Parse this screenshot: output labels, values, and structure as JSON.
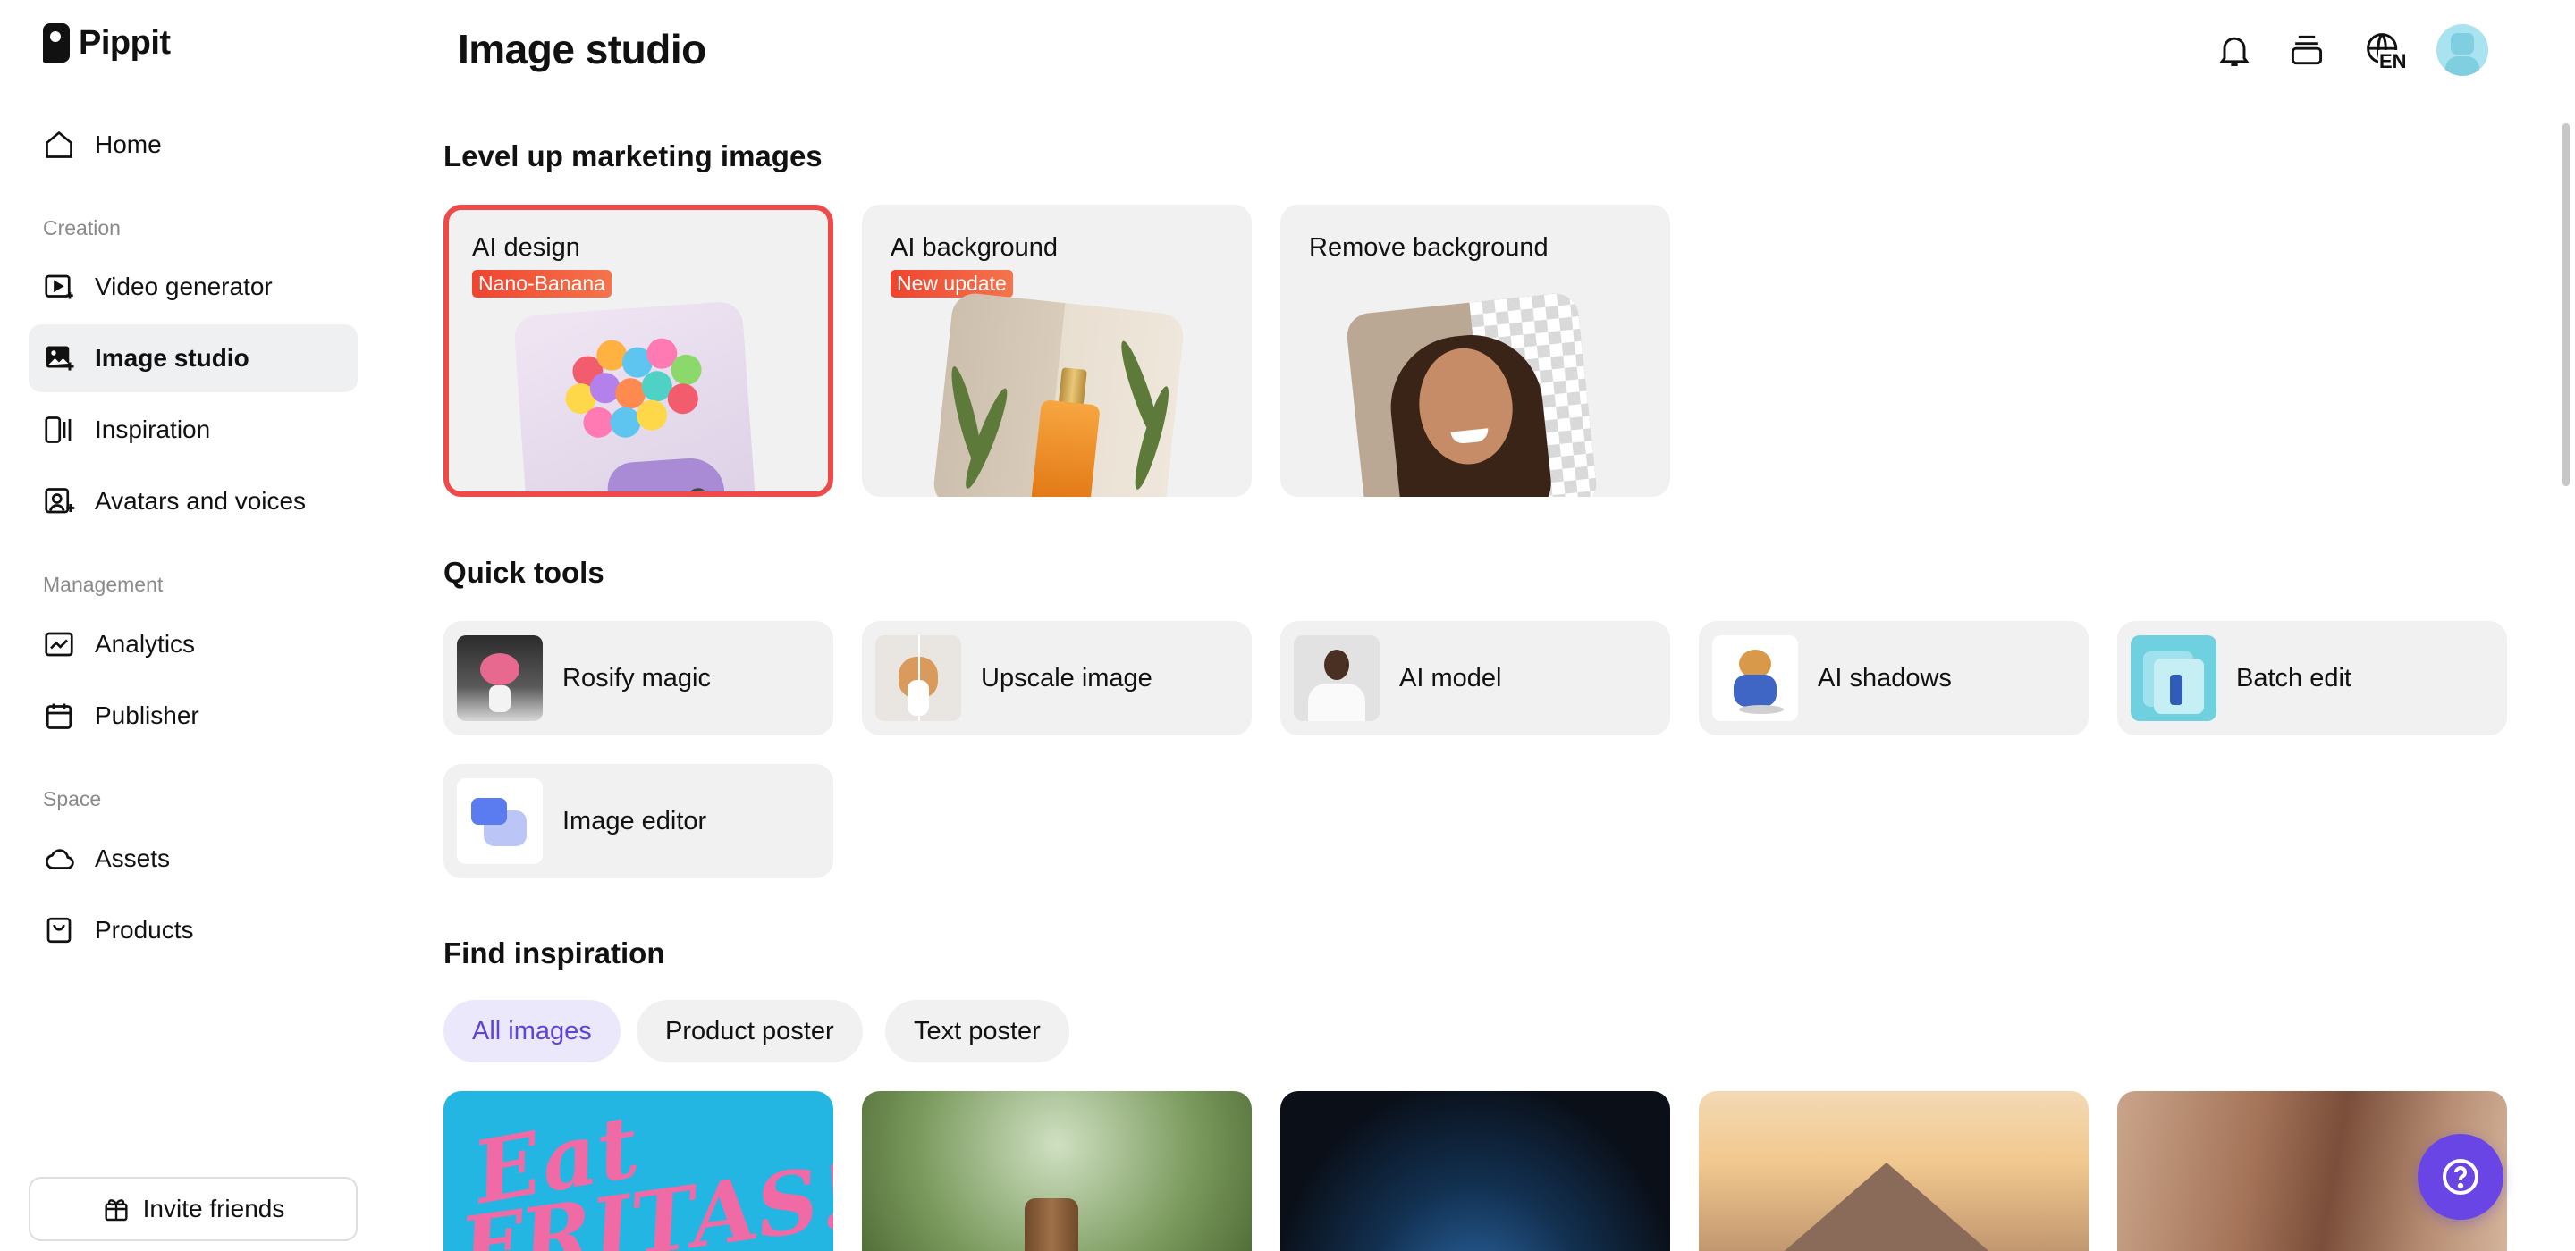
{
  "app": {
    "name": "Pippit"
  },
  "sidebar": {
    "home": "Home",
    "sections": {
      "creation": "Creation",
      "management": "Management",
      "space": "Space"
    },
    "creation_items": [
      {
        "label": "Video generator",
        "icon": "video-icon"
      },
      {
        "label": "Image studio",
        "icon": "image-icon",
        "active": true
      },
      {
        "label": "Inspiration",
        "icon": "inspiration-icon"
      },
      {
        "label": "Avatars and voices",
        "icon": "avatar-icon"
      }
    ],
    "management_items": [
      {
        "label": "Analytics",
        "icon": "analytics-icon"
      },
      {
        "label": "Publisher",
        "icon": "calendar-icon"
      }
    ],
    "space_items": [
      {
        "label": "Assets",
        "icon": "cloud-icon"
      },
      {
        "label": "Products",
        "icon": "bag-icon"
      }
    ],
    "invite": "Invite friends"
  },
  "header": {
    "title": "Image studio",
    "language_code": "EN"
  },
  "marketing": {
    "title": "Level up marketing images",
    "cards": [
      {
        "title": "AI design",
        "badge": "Nano-Banana",
        "selected": true
      },
      {
        "title": "AI background",
        "badge": "New update"
      },
      {
        "title": "Remove background"
      }
    ]
  },
  "quick_tools": {
    "title": "Quick tools",
    "items": [
      {
        "label": "Rosify magic"
      },
      {
        "label": "Upscale image"
      },
      {
        "label": "AI model"
      },
      {
        "label": "AI shadows"
      },
      {
        "label": "Batch edit"
      },
      {
        "label": "Image editor"
      }
    ]
  },
  "inspiration": {
    "title": "Find inspiration",
    "filters": [
      {
        "label": "All images",
        "active": true
      },
      {
        "label": "Product poster"
      },
      {
        "label": "Text poster"
      }
    ],
    "gallery_text": {
      "line1": "Eat",
      "line2": "FRITAS!"
    }
  },
  "colors": {
    "accent": "#6a45e6",
    "selected_border": "#ef4a4a",
    "badge": "#f0442f",
    "active_nav": "#eef0f2",
    "chip_active_text": "#5b44d8"
  }
}
